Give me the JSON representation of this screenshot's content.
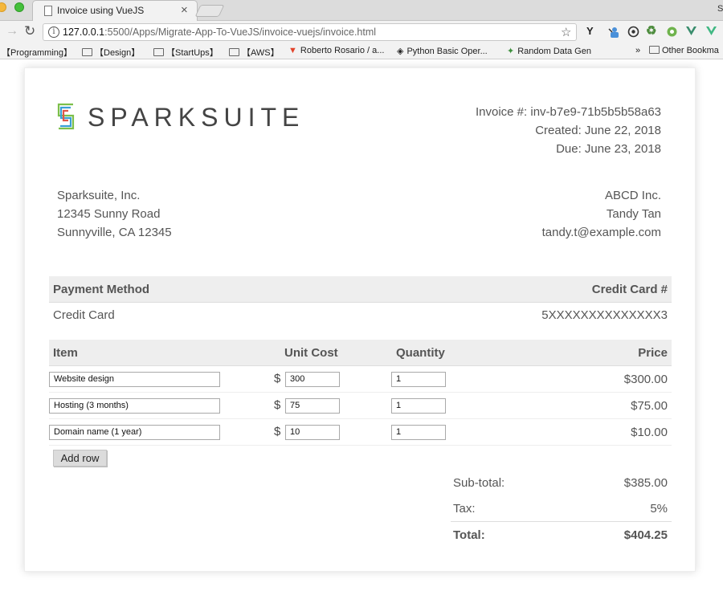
{
  "browser": {
    "tab_title": "Invoice using VueJS",
    "url_host": "127.0.0.1",
    "url_rest": ":5500/Apps/Migrate-App-To-VueJS/invoice-vuejs/invoice.html",
    "corner_text": "S",
    "bookmarks": [
      "【Programming】",
      "【Design】",
      "【StartUps】",
      "【AWS】",
      "Roberto Rosario / a...",
      "Python Basic Oper...",
      "Random Data Gen",
      "»",
      "Other Bookma"
    ],
    "extension_label": "Y"
  },
  "invoice": {
    "logo_text": "SPARKSUITE",
    "number_label": "Invoice #: inv-b7e9-71b5b5b58a63",
    "created_label": "Created: June 22, 2018",
    "due_label": "Due: June 23, 2018",
    "from": [
      "Sparksuite, Inc.",
      "12345 Sunny Road",
      "Sunnyville, CA 12345"
    ],
    "to": [
      "ABCD Inc.",
      "Tandy Tan",
      "tandy.t@example.com"
    ],
    "payment": {
      "heading_method": "Payment Method",
      "heading_card": "Credit Card #",
      "method": "Credit Card",
      "card": "5XXXXXXXXXXXXXX3"
    },
    "items_header": {
      "item": "Item",
      "unit_cost": "Unit Cost",
      "quantity": "Quantity",
      "price": "Price"
    },
    "items": [
      {
        "description": "Website design",
        "currency": "$",
        "cost": "300",
        "qty": "1",
        "price": "$300.00"
      },
      {
        "description": "Hosting (3 months)",
        "currency": "$",
        "cost": "75",
        "qty": "1",
        "price": "$75.00"
      },
      {
        "description": "Domain name (1 year)",
        "currency": "$",
        "cost": "10",
        "qty": "1",
        "price": "$10.00"
      }
    ],
    "add_row_label": "Add row",
    "subtotal_label": "Sub-total:",
    "subtotal_value": "$385.00",
    "tax_label": "Tax:",
    "tax_value": "5%",
    "total_label": "Total:",
    "total_value": "$404.25"
  },
  "colors": {
    "logo_green": "#7cbf4a",
    "logo_blue": "#3a9fd6",
    "logo_red": "#e0564a",
    "heading_bg": "#eeeeee"
  }
}
